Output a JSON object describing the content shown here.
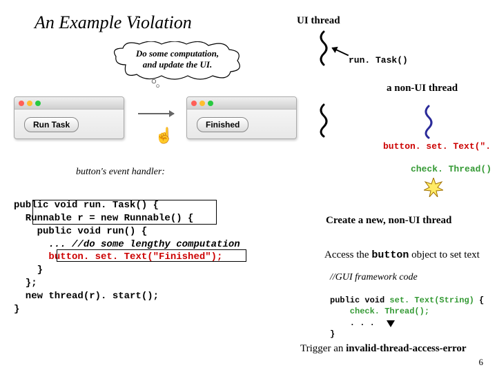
{
  "title": "An Example Violation",
  "ui_thread_label": "UI thread",
  "cloud": {
    "line1": "Do some computation,",
    "line2": "and update the UI."
  },
  "run_task_call": "run. Task()",
  "non_ui_thread_label": "a non-UI thread",
  "button_settext_call": "button. set. Text(\". \")",
  "check_thread_call": "check. Thread()",
  "event_handler_label": "button's event handler:",
  "window_left_button": "Run Task",
  "window_right_button": "Finished",
  "code": {
    "l1": "public void run. Task() {",
    "l2": "  Runnable r = new Runnable() {",
    "l3": "    public void run() {",
    "l4": "      ... //do some lengthy computation",
    "l5a": "      ",
    "l5b": "button. set. Text(\"Finished\");",
    "l6": "    }",
    "l7": "  };",
    "l8": "  new thread(r). start();",
    "l9": "}"
  },
  "create_label": "Create a new, non-UI thread",
  "access_label_prefix": "Access the ",
  "access_label_mono": "button",
  "access_label_suffix": " object to set text",
  "gui_comment": "//GUI  framework code",
  "gui_code": {
    "l1a": "public void ",
    "l1b": "set. Text(String)",
    "l1c": " {",
    "l2": "    check. Thread();",
    "l3": "    . . .",
    "l4": "}"
  },
  "trigger_prefix": "Trigger an ",
  "trigger_bold": "invalid-thread-access-error",
  "page_num": "6"
}
